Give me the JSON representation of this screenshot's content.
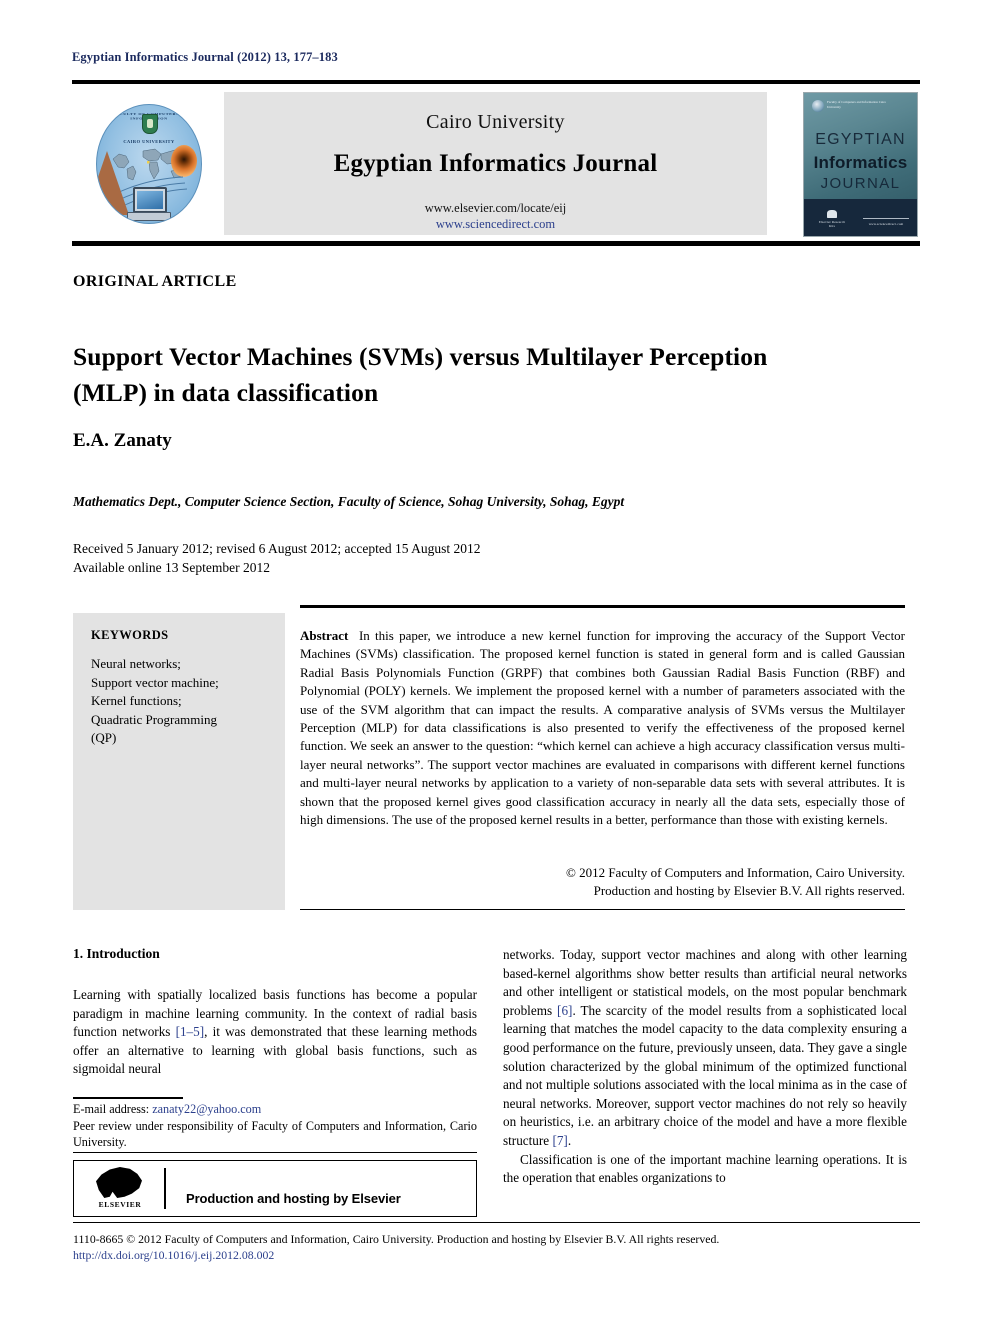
{
  "running_head": "Egyptian Informatics Journal (2012) 13, 177–183",
  "masthead": {
    "publisher": "Cairo University",
    "journal_title": "Egyptian Informatics Journal",
    "url_elsevier": "www.elsevier.com/locate/eij",
    "url_sciencedirect": "www.sciencedirect.com",
    "logo_ring_top": "FACULTY OF COMPUTERS & INFORMATION",
    "logo_ring_bottom": "CAIRO UNIVERSITY",
    "cover": {
      "line1": "EGYPTIAN",
      "line2": "Informatics",
      "line3": "JOURNAL",
      "badge_text": "Faculty of Computers and Information Cairo University",
      "footer_left": "Elsevier Research Kits",
      "footer_right": "www.sciencedirect.com"
    }
  },
  "article": {
    "type_label": "ORIGINAL ARTICLE",
    "title": "Support Vector Machines (SVMs) versus Multilayer Perception (MLP) in data classification",
    "author": "E.A. Zanaty",
    "affiliation": "Mathematics Dept., Computer Science Section, Faculty of Science, Sohag University, Sohag, Egypt",
    "received_line": "Received 5 January 2012; revised 6 August 2012; accepted 15 August 2012",
    "available_line": "Available online 13 September 2012"
  },
  "keywords": {
    "heading": "KEYWORDS",
    "items": "Neural networks; Support vector machine; Kernel functions; Quadratic Programming (QP)"
  },
  "abstract": {
    "label": "Abstract",
    "text": "In this paper, we introduce a new kernel function for improving the accuracy of the Support Vector Machines (SVMs) classification. The proposed kernel function is stated in general form and is called Gaussian Radial Basis Polynomials Function (GRPF) that combines both Gaussian Radial Basis Function (RBF) and Polynomial (POLY) kernels. We implement the proposed kernel with a number of parameters associated with the use of the SVM algorithm that can impact the results. A comparative analysis of SVMs versus the Multilayer Perception (MLP) for data classifications is also presented to verify the effectiveness of the proposed kernel function. We seek an answer to the question: “which kernel can achieve a high accuracy classification versus multi-layer neural networks”. The support vector machines are evaluated in comparisons with different kernel functions and multi-layer neural networks by application to a variety of non-separable data sets with several attributes. It is shown that the proposed kernel gives good classification accuracy in nearly all the data sets, especially those of high dimensions. The use of the proposed kernel results in a better, performance than those with existing kernels.",
    "copyright_line1": "© 2012 Faculty of Computers and Information, Cairo University.",
    "copyright_line2": "Production and hosting by Elsevier B.V. All rights reserved."
  },
  "body": {
    "section_title": "1. Introduction",
    "left_col_part1": "Learning with spatially localized basis functions has become a popular paradigm in machine learning community. In the context of radial basis function networks ",
    "left_col_cite1": "[1–5]",
    "left_col_part2": ", it was demonstrated that these learning methods offer an alternative to learning with global basis functions, such as sigmoidal neural",
    "right_col_p1_part1": "networks. Today, support vector machines and along with other learning based-kernel algorithms show better results than artificial neural networks and other intelligent or statistical models, on the most popular benchmark problems ",
    "right_col_cite1": "[6]",
    "right_col_p1_part2": ". The scarcity of the model results from a sophisticated local learning that matches the model capacity to the data complexity ensuring a good performance on the future, previously unseen, data. They gave a single solution characterized by the global minimum of the optimized functional and not multiple solutions associated with the local minima as in the case of neural networks. Moreover, support vector machines do not rely so heavily on heuristics, i.e. an arbitrary choice of the model and have a more flexible structure ",
    "right_col_cite2": "[7]",
    "right_col_p1_part3": ".",
    "right_col_p2": "Classification is one of the important machine learning operations. It is the operation that enables organizations to"
  },
  "footnote": {
    "email_label": "E-mail address: ",
    "email": "zanaty22@yahoo.com",
    "peer_review": "Peer review under responsibility of Faculty of Computers and Information, Cario University.",
    "elsevier_banner": "Production and hosting by Elsevier",
    "elsevier_logo_name": "ELSEVIER"
  },
  "page_footer": {
    "copyright": "1110-8665 © 2012 Faculty of Computers and Information, Cairo University. Production and hosting by Elsevier B.V. All rights reserved.",
    "doi": "http://dx.doi.org/10.1016/j.eij.2012.08.002"
  },
  "colors": {
    "header_navy": "#1b2a5e",
    "link_blue": "#2b3f8c",
    "panel_gray": "#e3e3e3"
  }
}
